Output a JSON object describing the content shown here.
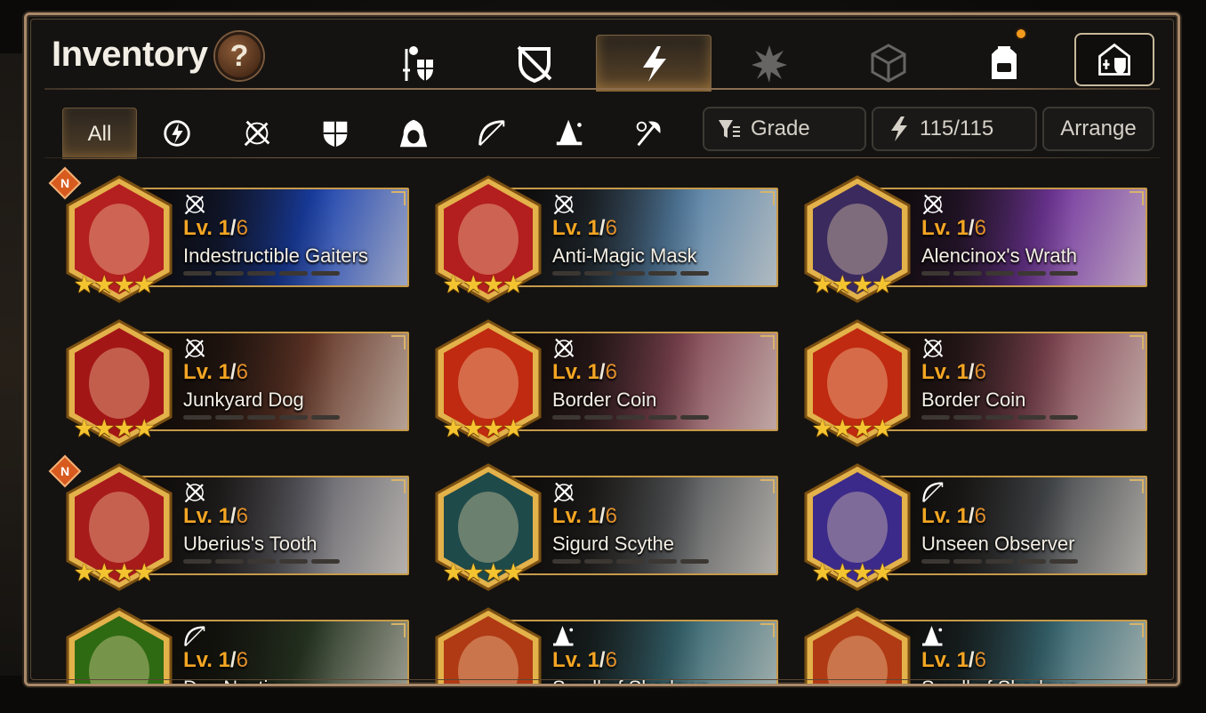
{
  "window": {
    "title": "Inventory",
    "help_label": "?"
  },
  "category_tabs": [
    {
      "name": "hero-equipment",
      "icon": "knight-shield-icon",
      "active": false
    },
    {
      "name": "no-equipment",
      "icon": "crossed-shield-icon",
      "active": false
    },
    {
      "name": "artifacts",
      "icon": "lightning-icon",
      "active": true
    },
    {
      "name": "catalysts",
      "icon": "spiky-crystal-icon",
      "active": false,
      "dimmed": true
    },
    {
      "name": "materials",
      "icon": "cube-icon",
      "active": false,
      "dimmed": true
    },
    {
      "name": "bag",
      "icon": "backpack-icon",
      "active": false,
      "notification": true
    }
  ],
  "guild_button": {
    "icon": "castle-icon"
  },
  "class_filters": {
    "all_label": "All",
    "items": [
      {
        "name": "soul-weaver",
        "icon": "lightning-orb-icon"
      },
      {
        "name": "knight-blade",
        "icon": "crossed-swords-icon"
      },
      {
        "name": "knight",
        "icon": "shield-icon"
      },
      {
        "name": "thief",
        "icon": "hood-icon"
      },
      {
        "name": "ranger",
        "icon": "bow-icon"
      },
      {
        "name": "mage",
        "icon": "wizard-hat-icon"
      },
      {
        "name": "warrior",
        "icon": "axe-icon"
      }
    ]
  },
  "controls": {
    "grade_label": "Grade",
    "capacity": "115/115",
    "arrange_label": "Arrange"
  },
  "colors": {
    "accent": "#f5a623",
    "frame_gold": "#c79a4a",
    "panel_border": "#a9896a"
  },
  "items": [
    {
      "name": "Indestructible Gaiters",
      "level": "1",
      "max_level": "6",
      "class_icon": "crossed-swords-icon",
      "new": true,
      "stars": 4,
      "hex_color": "#b41f1f",
      "art_color": "#1a44b8"
    },
    {
      "name": "Anti-Magic Mask",
      "level": "1",
      "max_level": "6",
      "class_icon": "crossed-swords-icon",
      "new": false,
      "stars": 4,
      "hex_color": "#b31e1e",
      "art_color": "#5a88b0"
    },
    {
      "name": "Alencinox's Wrath",
      "level": "1",
      "max_level": "6",
      "class_icon": "crossed-swords-icon",
      "new": false,
      "stars": 4,
      "hex_color": "#3a2a5e",
      "art_color": "#7a3aa8"
    },
    {
      "name": "Junkyard Dog",
      "level": "1",
      "max_level": "6",
      "class_icon": "crossed-swords-icon",
      "new": false,
      "stars": 4,
      "hex_color": "#a31616",
      "art_color": "#6b3a2a"
    },
    {
      "name": "Border Coin",
      "level": "1",
      "max_level": "6",
      "class_icon": "crossed-swords-icon",
      "new": false,
      "stars": 4,
      "hex_color": "#c02a10",
      "art_color": "#8a4a58"
    },
    {
      "name": "Border Coin",
      "level": "1",
      "max_level": "6",
      "class_icon": "crossed-swords-icon",
      "new": false,
      "stars": 4,
      "hex_color": "#c02a10",
      "art_color": "#8a4a58"
    },
    {
      "name": "Uberius's Tooth",
      "level": "1",
      "max_level": "6",
      "class_icon": "crossed-swords-icon",
      "new": true,
      "stars": 4,
      "hex_color": "#a81b1b",
      "art_color": "#6a6a72"
    },
    {
      "name": "Sigurd Scythe",
      "level": "1",
      "max_level": "6",
      "class_icon": "crossed-swords-icon",
      "new": false,
      "stars": 4,
      "hex_color": "#1e4a4a",
      "art_color": "#5a5d60"
    },
    {
      "name": "Unseen Observer",
      "level": "1",
      "max_level": "6",
      "class_icon": "bow-icon",
      "new": false,
      "stars": 4,
      "hex_color": "#3b2a8a",
      "art_color": "#4a4e52"
    },
    {
      "name": "Dux Noctis",
      "level": "1",
      "max_level": "6",
      "class_icon": "bow-icon",
      "new": false,
      "stars": 4,
      "hex_color": "#2e6a12",
      "art_color": "#2a3a26"
    },
    {
      "name": "Scroll of Shadows",
      "level": "1",
      "max_level": "6",
      "class_icon": "wizard-hat-icon",
      "new": false,
      "stars": 4,
      "hex_color": "#b03a14",
      "art_color": "#3a6e7a"
    },
    {
      "name": "Scroll of Shadows",
      "level": "1",
      "max_level": "6",
      "class_icon": "wizard-hat-icon",
      "new": false,
      "stars": 4,
      "hex_color": "#b03a14",
      "art_color": "#3a6e7a"
    }
  ]
}
